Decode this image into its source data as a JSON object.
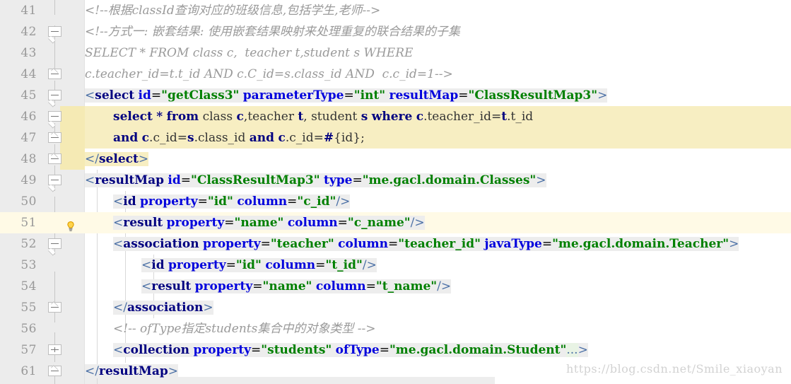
{
  "editor": {
    "watermark": "https://blog.csdn.net/Smile_xiaoyan",
    "colors": {
      "gutter_bg": "#ececec",
      "selection_yellow": "#f5eab4",
      "caret_line": "#fffae6",
      "text_run_bg": "#ededed",
      "folded_placeholder_bg": "#e8f3e4",
      "comment": "#9a9a9a",
      "tag": "#000080",
      "attribute": "#0000dd",
      "attribute_value": "#008000",
      "bracket": "#4a6fa5",
      "sql_keyword": "#000080",
      "plain_text": "#333333",
      "line_number": "#999999"
    },
    "icons": {
      "lightbulb": "lightbulb-icon",
      "fold_collapse": "fold-minus-icon",
      "fold_expand": "fold-plus-icon"
    },
    "lines": [
      {
        "no": "41",
        "fold": "none",
        "caret": false,
        "selected": false,
        "text": "<!--根据classId查询对应的班级信息,包括学生,老师-->"
      },
      {
        "no": "42",
        "fold": "start",
        "caret": false,
        "selected": false,
        "text": "<!--方式一: 嵌套结果: 使用嵌套结果映射来处理重复的联合结果的子集"
      },
      {
        "no": "43",
        "fold": "none",
        "caret": false,
        "selected": false,
        "text": "SELECT * FROM class c,  teacher t,student s WHERE"
      },
      {
        "no": "44",
        "fold": "end",
        "caret": false,
        "selected": false,
        "text": "c.teacher_id=t.t_id AND c.C_id=s.class_id AND  c.c_id=1-->"
      },
      {
        "no": "45",
        "fold": "start",
        "caret": false,
        "selected": false,
        "text": "<select id=\"getClass3\" parameterType=\"int\" resultMap=\"ClassResultMap3\">"
      },
      {
        "no": "46",
        "fold": "start",
        "caret": false,
        "selected": true,
        "text": "    select * from class c,teacher t, student s where c.teacher_id=t.t_id"
      },
      {
        "no": "47",
        "fold": "end",
        "caret": false,
        "selected": true,
        "text": "    and c.c_id=s.class_id and c.c_id=#{id};"
      },
      {
        "no": "48",
        "fold": "end",
        "caret": false,
        "selected": true,
        "text": "</select>"
      },
      {
        "no": "49",
        "fold": "start",
        "caret": false,
        "selected": false,
        "text": "<resultMap id=\"ClassResultMap3\" type=\"me.gacl.domain.Classes\">"
      },
      {
        "no": "50",
        "fold": "none",
        "caret": false,
        "selected": false,
        "text": "    <id property=\"id\" column=\"c_id\"/>"
      },
      {
        "no": "51",
        "fold": "bulb",
        "caret": true,
        "selected": false,
        "text": "    <result property=\"name\" column=\"c_name\"/>"
      },
      {
        "no": "52",
        "fold": "start",
        "caret": false,
        "selected": false,
        "text": "    <association property=\"teacher\" column=\"teacher_id\" javaType=\"me.gacl.domain.Teacher\">"
      },
      {
        "no": "53",
        "fold": "none",
        "caret": false,
        "selected": false,
        "text": "        <id property=\"id\" column=\"t_id\"/>"
      },
      {
        "no": "54",
        "fold": "none",
        "caret": false,
        "selected": false,
        "text": "        <result property=\"name\" column=\"t_name\"/>"
      },
      {
        "no": "55",
        "fold": "end",
        "caret": false,
        "selected": false,
        "text": "    </association>"
      },
      {
        "no": "56",
        "fold": "none",
        "caret": false,
        "selected": false,
        "text": "    <!-- ofType指定students集合中的对象类型 -->"
      },
      {
        "no": "57",
        "fold": "plus",
        "caret": false,
        "selected": false,
        "text": "    <collection property=\"students\" ofType=\"me.gacl.domain.Student\"...>"
      },
      {
        "no": "61",
        "fold": "end",
        "caret": false,
        "selected": false,
        "text": "</resultMap>"
      }
    ]
  }
}
